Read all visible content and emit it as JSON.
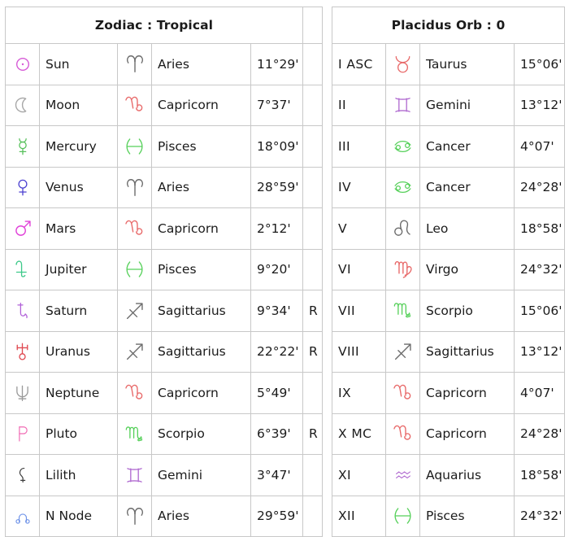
{
  "headers": {
    "left": "Zodiac : Tropical",
    "right": "Placidus Orb : 0"
  },
  "glyph_colors": {
    "sun": "#d65ad6",
    "moon": "#a6a6a6",
    "mercury": "#56c05a",
    "venus": "#4a3fd0",
    "mars": "#e040d8",
    "jupiter": "#3ec98a",
    "saturn": "#b060d8",
    "uranus": "#e04a52",
    "neptune": "#9a9a9a",
    "pluto": "#f06ab4",
    "lilith": "#3a3a3a",
    "nnode": "#6f93e8",
    "fire": "#6b6b6b",
    "earth": "#e86a6a",
    "air": "#b06ad0",
    "water": "#56d05a"
  },
  "planets": [
    {
      "icon": "sun-glyph",
      "name": "Sun",
      "sign_icon": "aries-glyph",
      "sign": "Aries",
      "degree": "11°29'",
      "retro": ""
    },
    {
      "icon": "moon-glyph",
      "name": "Moon",
      "sign_icon": "capricorn-glyph",
      "sign": "Capricorn",
      "degree": "7°37'",
      "retro": ""
    },
    {
      "icon": "mercury-glyph",
      "name": "Mercury",
      "sign_icon": "pisces-glyph",
      "sign": "Pisces",
      "degree": "18°09'",
      "retro": ""
    },
    {
      "icon": "venus-glyph",
      "name": "Venus",
      "sign_icon": "aries-glyph",
      "sign": "Aries",
      "degree": "28°59'",
      "retro": ""
    },
    {
      "icon": "mars-glyph",
      "name": "Mars",
      "sign_icon": "capricorn-glyph",
      "sign": "Capricorn",
      "degree": "2°12'",
      "retro": ""
    },
    {
      "icon": "jupiter-glyph",
      "name": "Jupiter",
      "sign_icon": "pisces-glyph",
      "sign": "Pisces",
      "degree": "9°20'",
      "retro": ""
    },
    {
      "icon": "saturn-glyph",
      "name": "Saturn",
      "sign_icon": "sagittarius-glyph",
      "sign": "Sagittarius",
      "degree": "9°34'",
      "retro": "R"
    },
    {
      "icon": "uranus-glyph",
      "name": "Uranus",
      "sign_icon": "sagittarius-glyph",
      "sign": "Sagittarius",
      "degree": "22°22'",
      "retro": "R"
    },
    {
      "icon": "neptune-glyph",
      "name": "Neptune",
      "sign_icon": "capricorn-glyph",
      "sign": "Capricorn",
      "degree": "5°49'",
      "retro": ""
    },
    {
      "icon": "pluto-glyph",
      "name": "Pluto",
      "sign_icon": "scorpio-glyph",
      "sign": "Scorpio",
      "degree": "6°39'",
      "retro": "R"
    },
    {
      "icon": "lilith-glyph",
      "name": "Lilith",
      "sign_icon": "gemini-glyph",
      "sign": "Gemini",
      "degree": "3°47'",
      "retro": ""
    },
    {
      "icon": "nnode-glyph",
      "name": "N Node",
      "sign_icon": "aries-glyph",
      "sign": "Aries",
      "degree": "29°59'",
      "retro": ""
    }
  ],
  "houses": [
    {
      "house": "I ASC",
      "sign_icon": "taurus-glyph",
      "sign": "Taurus",
      "degree": "15°06'"
    },
    {
      "house": "II",
      "sign_icon": "gemini-glyph",
      "sign": "Gemini",
      "degree": "13°12'"
    },
    {
      "house": "III",
      "sign_icon": "cancer-glyph",
      "sign": "Cancer",
      "degree": "4°07'"
    },
    {
      "house": "IV",
      "sign_icon": "cancer-glyph",
      "sign": "Cancer",
      "degree": "24°28'"
    },
    {
      "house": "V",
      "sign_icon": "leo-glyph",
      "sign": "Leo",
      "degree": "18°58'"
    },
    {
      "house": "VI",
      "sign_icon": "virgo-glyph",
      "sign": "Virgo",
      "degree": "24°32'"
    },
    {
      "house": "VII",
      "sign_icon": "scorpio-glyph",
      "sign": "Scorpio",
      "degree": "15°06'"
    },
    {
      "house": "VIII",
      "sign_icon": "sagittarius-glyph",
      "sign": "Sagittarius",
      "degree": "13°12'"
    },
    {
      "house": "IX",
      "sign_icon": "capricorn-glyph",
      "sign": "Capricorn",
      "degree": "4°07'"
    },
    {
      "house": "X MC",
      "sign_icon": "capricorn-glyph",
      "sign": "Capricorn",
      "degree": "24°28'"
    },
    {
      "house": "XI",
      "sign_icon": "aquarius-glyph",
      "sign": "Aquarius",
      "degree": "18°58'"
    },
    {
      "house": "XII",
      "sign_icon": "pisces-glyph",
      "sign": "Pisces",
      "degree": "24°32'"
    }
  ]
}
